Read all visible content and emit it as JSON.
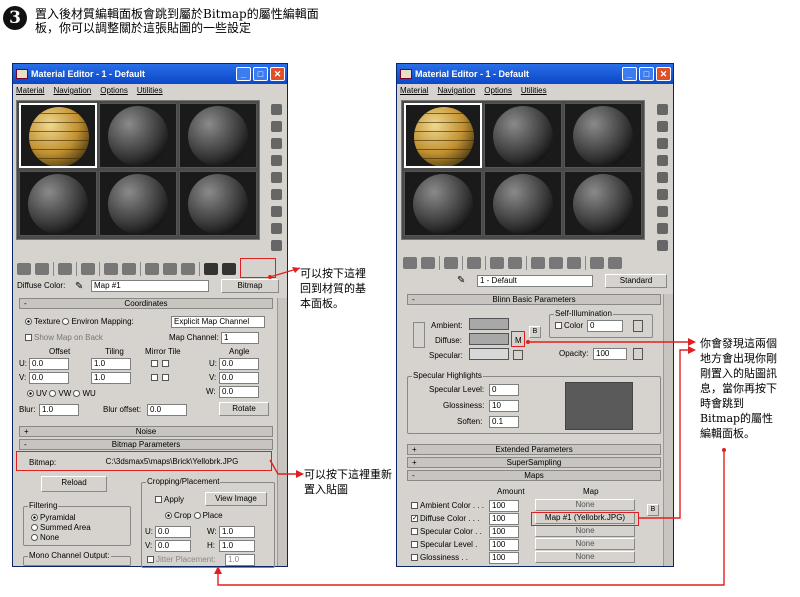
{
  "step": {
    "number": "3",
    "text": "置入後材質編輯面板會跳到屬於Bitmap的屬性編輯面板，你可以調整關於這張貼圖的一些設定"
  },
  "notes": {
    "back": "可以按下這裡回到材質的基本面板。",
    "reload": "可以按下這裡重新置入貼圖",
    "right": "你會發現這兩個地方會出現你剛剛置入的貼圖訊息，當你再按下時會跳到Bitmap的屬性編輯面板。"
  },
  "left": {
    "title": "Material Editor - 1 - Default",
    "menu": [
      "Material",
      "Navigation",
      "Options",
      "Utilities"
    ],
    "diffuse_label": "Diffuse Color:",
    "map_name": "Map #1",
    "type_button": "Bitmap",
    "coordinates": {
      "title": "Coordinates",
      "texture": "Texture",
      "environ": "Environ",
      "mapping_label": "Mapping:",
      "mapping_value": "Explicit Map Channel",
      "show_map": "Show Map on Back",
      "channel_label": "Map Channel:",
      "channel_value": "1",
      "offset": "Offset",
      "tiling": "Tiling",
      "mirror_tile": "Mirror Tile",
      "angle": "Angle",
      "u": "U:",
      "v": "V:",
      "w": "W:",
      "u_off": "0.0",
      "v_off": "0.0",
      "u_til": "1.0",
      "v_til": "1.0",
      "u_ang": "0.0",
      "v_ang": "0.0",
      "w_ang": "0.0",
      "uv": "UV",
      "vw": "VW",
      "wu": "WU",
      "blur_label": "Blur:",
      "blur": "1.0",
      "blur_off_label": "Blur offset:",
      "blur_off": "0.0",
      "rotate": "Rotate"
    },
    "noise": "Noise",
    "bitmap_params": "Bitmap Parameters",
    "bitmap_label": "Bitmap:",
    "bitmap_path": "C:\\3dsmax5\\maps\\Brick\\Yellobrk.JPG",
    "reload": "Reload",
    "filtering": {
      "title": "Filtering",
      "pyramidal": "Pyramidal",
      "summed": "Summed Area",
      "none": "None"
    },
    "cropping": {
      "title": "Cropping/Placement",
      "apply": "Apply",
      "view": "View Image",
      "crop": "Crop",
      "place": "Place",
      "u": "U:",
      "v": "V:",
      "w": "W:",
      "h": "H:",
      "u_val": "0.0",
      "v_val": "0.0",
      "w_val": "1.0",
      "h_val": "1.0",
      "jitter": "Jitter Placement:",
      "jitter_val": "1.0"
    },
    "mono": "Mono Channel Output:"
  },
  "right": {
    "title": "Material Editor - 1 - Default",
    "menu": [
      "Material",
      "Navigation",
      "Options",
      "Utilities"
    ],
    "mat_name": "1 - Default",
    "type_button": "Standard",
    "blinn": "Blinn Basic Parameters",
    "self_illum": "Self-Illumination",
    "color_label": "Color",
    "color_val": "0",
    "ambient": "Ambient:",
    "diffuse": "Diffuse:",
    "specular": "Specular:",
    "m": "M",
    "opacity_label": "Opacity:",
    "opacity_val": "100",
    "spec_highlights": "Specular Highlights",
    "spec_level": "Specular Level:",
    "spec_level_val": "0",
    "gloss": "Glossiness:",
    "gloss_val": "10",
    "soften": "Soften:",
    "soften_val": "0.1",
    "extended": "Extended Parameters",
    "supersampling": "SuperSampling",
    "maps": "Maps",
    "amount": "Amount",
    "map": "Map",
    "map_rows": [
      {
        "name": "Ambient Color . . .",
        "amount": "100",
        "map": "None",
        "checked": false
      },
      {
        "name": "Diffuse Color . . .",
        "amount": "100",
        "map": "Map #1 (Yellobrk.JPG)",
        "checked": true
      },
      {
        "name": "Specular Color . .",
        "amount": "100",
        "map": "None",
        "checked": false
      },
      {
        "name": "Specular Level .",
        "amount": "100",
        "map": "None",
        "checked": false
      },
      {
        "name": "Glossiness . .",
        "amount": "100",
        "map": "None",
        "checked": false
      }
    ]
  },
  "colors": {
    "accent": "#e02020",
    "titlebar": "#0a48c8",
    "panel": "#d6d3ce"
  }
}
